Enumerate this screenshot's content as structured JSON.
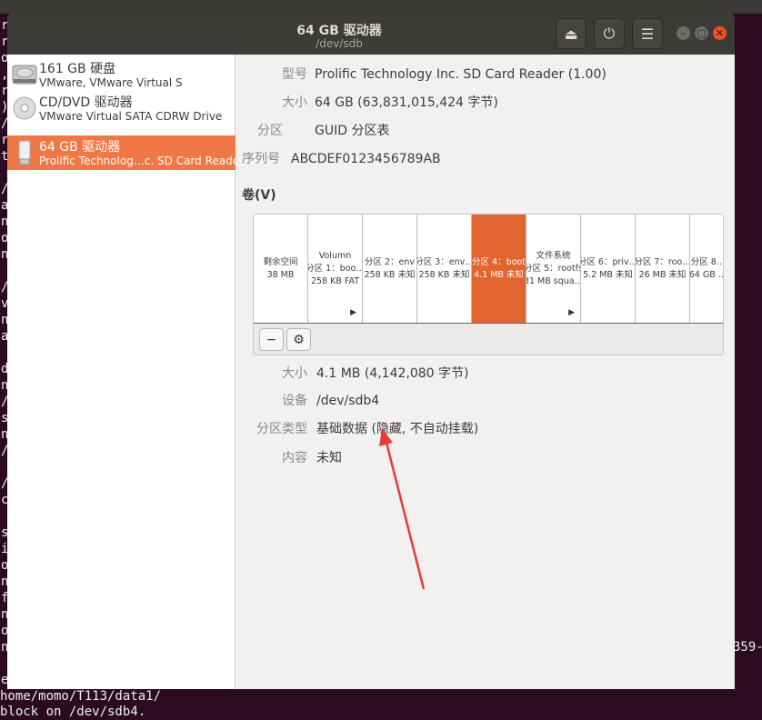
{
  "terminal": {
    "left_chars": "r\nr\no\n,\nr\n)\n/\nr\nt\n\n/\na\nn\no\nn\n\n/\nv\nn\na\n\nd\nn\n/\ns\nn\n/\n\n/\nc\n\ns\ni\no\nn\nf\nn\no\nn\n\ne",
    "bottom_lines": "home/momo/T113/data1/\nblock on /dev/sdb4.",
    "right_fragment": "359-"
  },
  "window": {
    "title": "64 GB 驱动器",
    "subtitle": "/dev/sdb",
    "icons": {
      "eject": "eject-icon",
      "power": "power-icon",
      "menu": "hamburger-menu-icon"
    }
  },
  "sidebar": {
    "items": [
      {
        "name": "161 GB 硬盘",
        "desc": "VMware, VMware Virtual S",
        "icon": "hard-disk-icon"
      },
      {
        "name": "CD/DVD 驱动器",
        "desc": "VMware Virtual SATA CDRW Drive",
        "icon": "optical-disc-icon"
      },
      {
        "name": "64 GB 驱动器",
        "desc": "Prolific Technolog…c. SD Card Reader",
        "icon": "usb-drive-icon",
        "selected": true
      }
    ]
  },
  "drive": {
    "model_label": "型号",
    "model": "Prolific Technology Inc. SD Card Reader (1.00)",
    "size_label": "大小",
    "size": "64 GB (63,831,015,424 字节)",
    "partitioning_label": "分区",
    "partitioning": "GUID 分区表",
    "serial_label": "序列号",
    "serial": "ABCDEF0123456789AB"
  },
  "volumes": {
    "heading": "卷(V)",
    "segments": [
      {
        "l1": "",
        "l2": "剩余空间",
        "l3": "38 MB"
      },
      {
        "l1": "Volumn",
        "l2": "分区 1：boo…",
        "l3": "258 KB FAT",
        "arrow": true
      },
      {
        "l1": "",
        "l2": "分区 2：env",
        "l3": "258 KB 未知"
      },
      {
        "l1": "",
        "l2": "分区 3：env…",
        "l3": "258 KB 未知"
      },
      {
        "l1": "",
        "l2": "分区 4：boot",
        "l3": "4.1 MB 未知",
        "selected": true
      },
      {
        "l1": "文件系统",
        "l2": "分区 5：rootfs",
        "l3": "31 MB squa…",
        "arrow": true
      },
      {
        "l1": "",
        "l2": "分区 6：priv…",
        "l3": "5.2 MB 未知"
      },
      {
        "l1": "",
        "l2": "分区 7：roo…",
        "l3": "26 MB 未知"
      },
      {
        "l1": "",
        "l2": "分区 8…",
        "l3": "64 GB …"
      }
    ],
    "accent": "#e2652f"
  },
  "partition": {
    "size_label": "大小",
    "size": "4.1 MB (4,142,080 字节)",
    "device_label": "设备",
    "device": "/dev/sdb4",
    "type_label": "分区类型",
    "type": "基础数据 (隐藏, 不自动挂载)",
    "contents_label": "内容",
    "contents": "未知"
  }
}
